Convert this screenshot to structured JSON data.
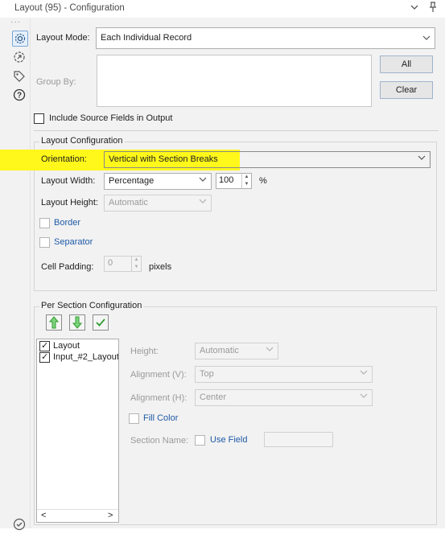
{
  "window": {
    "title": "Layout (95) - Configuration"
  },
  "titlebar_icons": [
    "chevron-down-icon",
    "pin-icon"
  ],
  "sidebar": {
    "items": [
      "settings-icon",
      "navigate-icon",
      "tag-icon",
      "help-icon",
      "check-circle-icon"
    ]
  },
  "layout_mode": {
    "label": "Layout Mode:",
    "value": "Each Individual Record"
  },
  "group_by": {
    "label": "Group By:"
  },
  "buttons": {
    "all": "All",
    "clear": "Clear"
  },
  "include_source": {
    "label": "Include Source Fields in Output",
    "checked": false
  },
  "layout_config": {
    "title": "Layout Configuration",
    "orientation": {
      "label": "Orientation:",
      "value": "Vertical with Section Breaks"
    },
    "width": {
      "label": "Layout Width:",
      "value": "Percentage",
      "number": "100",
      "unit": "%"
    },
    "height": {
      "label": "Layout Height:",
      "value": "Automatic"
    },
    "border": {
      "label": "Border",
      "checked": false
    },
    "separator": {
      "label": "Separator",
      "checked": false
    },
    "cell_padding": {
      "label": "Cell Padding:",
      "value": "0",
      "unit": "pixels"
    }
  },
  "per_section": {
    "title": "Per Section Configuration",
    "items": [
      {
        "label": "Layout",
        "checked": true
      },
      {
        "label": "Input_#2_Layout",
        "checked": true
      }
    ],
    "height": {
      "label": "Height:",
      "value": "Automatic"
    },
    "align_v": {
      "label": "Alignment (V):",
      "value": "Top"
    },
    "align_h": {
      "label": "Alignment (H):",
      "value": "Center"
    },
    "fill_color": {
      "label": "Fill Color"
    },
    "section_name": {
      "label": "Section Name:",
      "use_field": "Use Field"
    }
  },
  "colors": {
    "highlight": "#fff81a",
    "accent": "#1e5aa8",
    "up_arrow": "#2e9e2e"
  }
}
